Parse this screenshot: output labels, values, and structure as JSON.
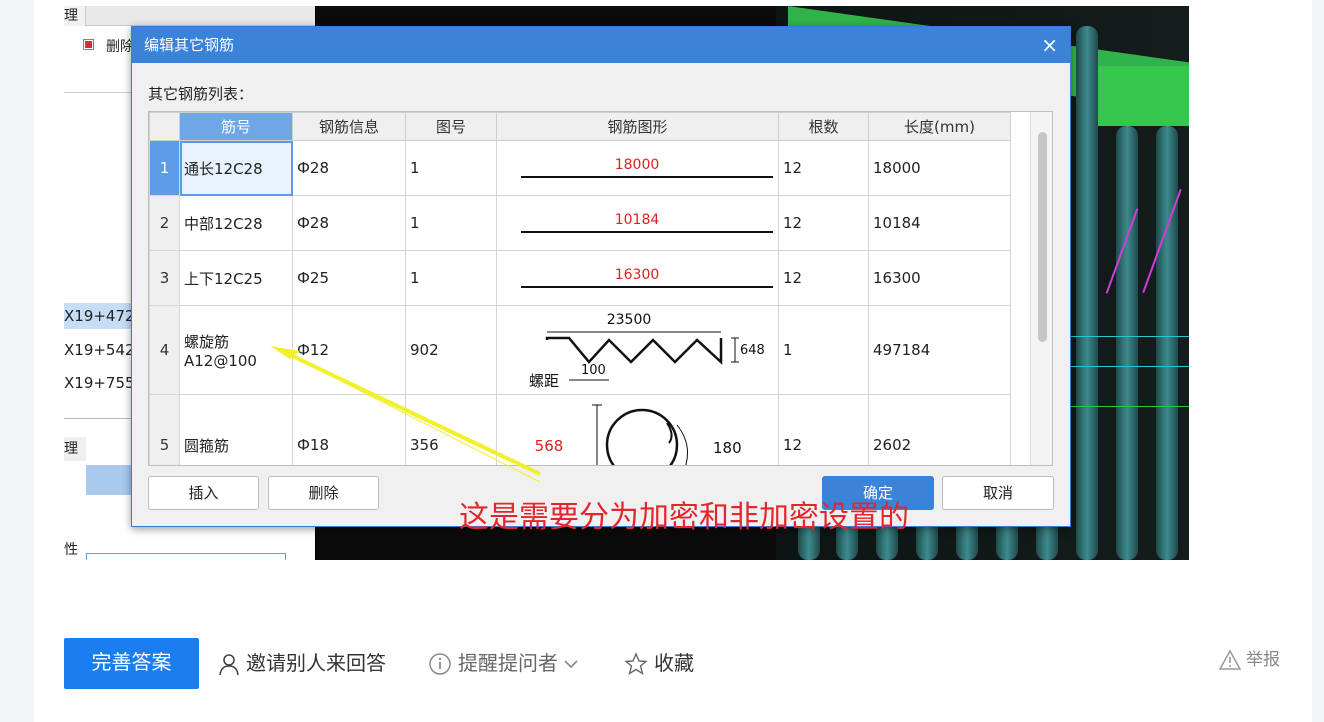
{
  "dialog": {
    "title": "编辑其它钢筋",
    "close": "×",
    "list_label": "其它钢筋列表：",
    "columns": [
      "筋号",
      "钢筋信息",
      "图号",
      "钢筋图形",
      "根数",
      "长度(mm)"
    ],
    "rows": [
      {
        "n": "1",
        "name": "通长12C28",
        "info": "Ф28",
        "fig": "1",
        "shape_label": "18000",
        "count": "12",
        "length": "18000"
      },
      {
        "n": "2",
        "name": "中部12C28",
        "info": "Ф28",
        "fig": "1",
        "shape_label": "10184",
        "count": "12",
        "length": "10184"
      },
      {
        "n": "3",
        "name": "上下12C25",
        "info": "Ф25",
        "fig": "1",
        "shape_label": "16300",
        "count": "12",
        "length": "16300"
      },
      {
        "n": "4",
        "name": "螺旋筋",
        "name2": "A12@100",
        "info": "Ф12",
        "fig": "902",
        "count": "1",
        "length": "497184",
        "spiral": {
          "top": "23500",
          "height": "648",
          "pitch": "100",
          "pitch_label": "螺距"
        }
      },
      {
        "n": "5",
        "name": "圆箍筋",
        "info": "Ф18",
        "fig": "356",
        "count": "12",
        "length": "2602",
        "hoop": {
          "dia": "568",
          "hook": "180"
        }
      }
    ],
    "buttons": {
      "insert": "插入",
      "delete": "删除",
      "ok": "确定",
      "cancel": "取消"
    }
  },
  "annotation": "这是需要分为加密和非加密设置的",
  "left_app": {
    "tab": "理",
    "toolbar_text": "删除",
    "rows": [
      "X19+472",
      "X19+542",
      "X19+755"
    ],
    "tab2": "理",
    "prop_label": "性"
  },
  "actions": {
    "answer": "完善答案",
    "invite": "邀请别人来回答",
    "remind": "提醒提问者",
    "favorite": "收藏",
    "report": "举报"
  },
  "colors": {
    "accent": "#1a7ef0",
    "dialog_blue": "#3b82d9",
    "annotation_red": "#e3262d",
    "dim_red": "#e02020"
  }
}
